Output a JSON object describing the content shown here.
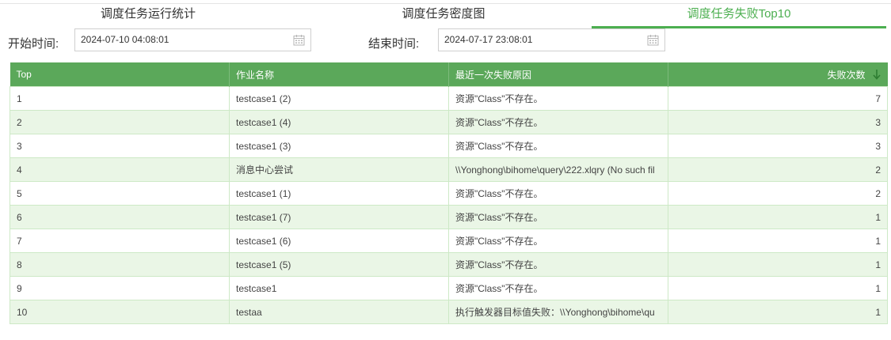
{
  "tabs": [
    {
      "label": "调度任务运行统计",
      "active": false
    },
    {
      "label": "调度任务密度图",
      "active": false
    },
    {
      "label": "调度任务失败Top10",
      "active": true
    }
  ],
  "filters": {
    "start_label": "开始时间:",
    "start_value": "2024-07-10 04:08:01",
    "end_label": "结束时间:",
    "end_value": "2024-07-17 23:08:01"
  },
  "table": {
    "headers": [
      "Top",
      "作业名称",
      "最近一次失败原因",
      "失败次数"
    ],
    "rows": [
      {
        "top": "1",
        "name": "testcase1 (2)",
        "reason": "资源\"Class\"不存在。",
        "count": "7"
      },
      {
        "top": "2",
        "name": "testcase1 (4)",
        "reason": "资源\"Class\"不存在。",
        "count": "3"
      },
      {
        "top": "3",
        "name": "testcase1 (3)",
        "reason": "资源\"Class\"不存在。",
        "count": "3"
      },
      {
        "top": "4",
        "name": "消息中心尝试",
        "reason": "\\\\Yonghong\\bihome\\query\\222.xlqry (No such fil",
        "count": "2"
      },
      {
        "top": "5",
        "name": "testcase1 (1)",
        "reason": "资源\"Class\"不存在。",
        "count": "2"
      },
      {
        "top": "6",
        "name": "testcase1 (7)",
        "reason": "资源\"Class\"不存在。",
        "count": "1"
      },
      {
        "top": "7",
        "name": "testcase1 (6)",
        "reason": "资源\"Class\"不存在。",
        "count": "1"
      },
      {
        "top": "8",
        "name": "testcase1 (5)",
        "reason": "资源\"Class\"不存在。",
        "count": "1"
      },
      {
        "top": "9",
        "name": "testcase1",
        "reason": "资源\"Class\"不存在。",
        "count": "1"
      },
      {
        "top": "10",
        "name": "testaa",
        "reason": "执行触发器目标值失败：\\\\Yonghong\\bihome\\qu",
        "count": "1"
      }
    ]
  },
  "colors": {
    "accent": "#4caf50",
    "header_bg": "#5ba85a",
    "row_alt": "#eaf6e6"
  },
  "icons": {
    "date_picker": "calendar-icon",
    "sort": "sort-down-arrow-icon"
  }
}
